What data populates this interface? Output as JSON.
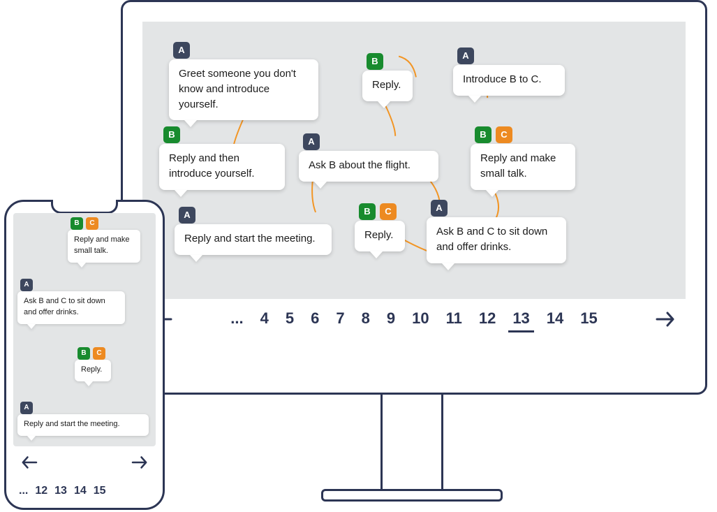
{
  "desktop": {
    "cards": {
      "c1": {
        "tags": [
          "A"
        ],
        "text": "Greet someone you don't know and introduce yourself."
      },
      "c2": {
        "tags": [
          "B"
        ],
        "text": "Reply."
      },
      "c3": {
        "tags": [
          "A"
        ],
        "text": "Introduce B to C."
      },
      "c4": {
        "tags": [
          "B"
        ],
        "text": "Reply and then introduce yourself."
      },
      "c5": {
        "tags": [
          "A"
        ],
        "text": "Ask B about the flight."
      },
      "c6": {
        "tags": [
          "B",
          "C"
        ],
        "text": "Reply and make small talk."
      },
      "c7": {
        "tags": [
          "A"
        ],
        "text": "Reply and start the meeting."
      },
      "c8": {
        "tags": [
          "B",
          "C"
        ],
        "text": "Reply."
      },
      "c9": {
        "tags": [
          "A"
        ],
        "text": "Ask B and C to sit down and offer drinks."
      }
    },
    "pager": {
      "ellipsis": "...",
      "pages": [
        "4",
        "5",
        "6",
        "7",
        "8",
        "9",
        "10",
        "11",
        "12",
        "13",
        "14",
        "15"
      ],
      "current": "13"
    }
  },
  "phone": {
    "cards": {
      "p1": {
        "tags": [
          "B",
          "C"
        ],
        "text": "Reply and make small talk."
      },
      "p2": {
        "tags": [
          "A"
        ],
        "text": "Ask B and C to sit down and offer drinks."
      },
      "p3": {
        "tags": [
          "B",
          "C"
        ],
        "text": "Reply."
      },
      "p4": {
        "tags": [
          "A"
        ],
        "text": "Reply and start the meeting."
      }
    },
    "pager": {
      "ellipsis": "...",
      "pages": [
        "12",
        "13",
        "14",
        "15"
      ]
    }
  },
  "speakers": {
    "A": "A",
    "B": "B",
    "C": "C"
  }
}
